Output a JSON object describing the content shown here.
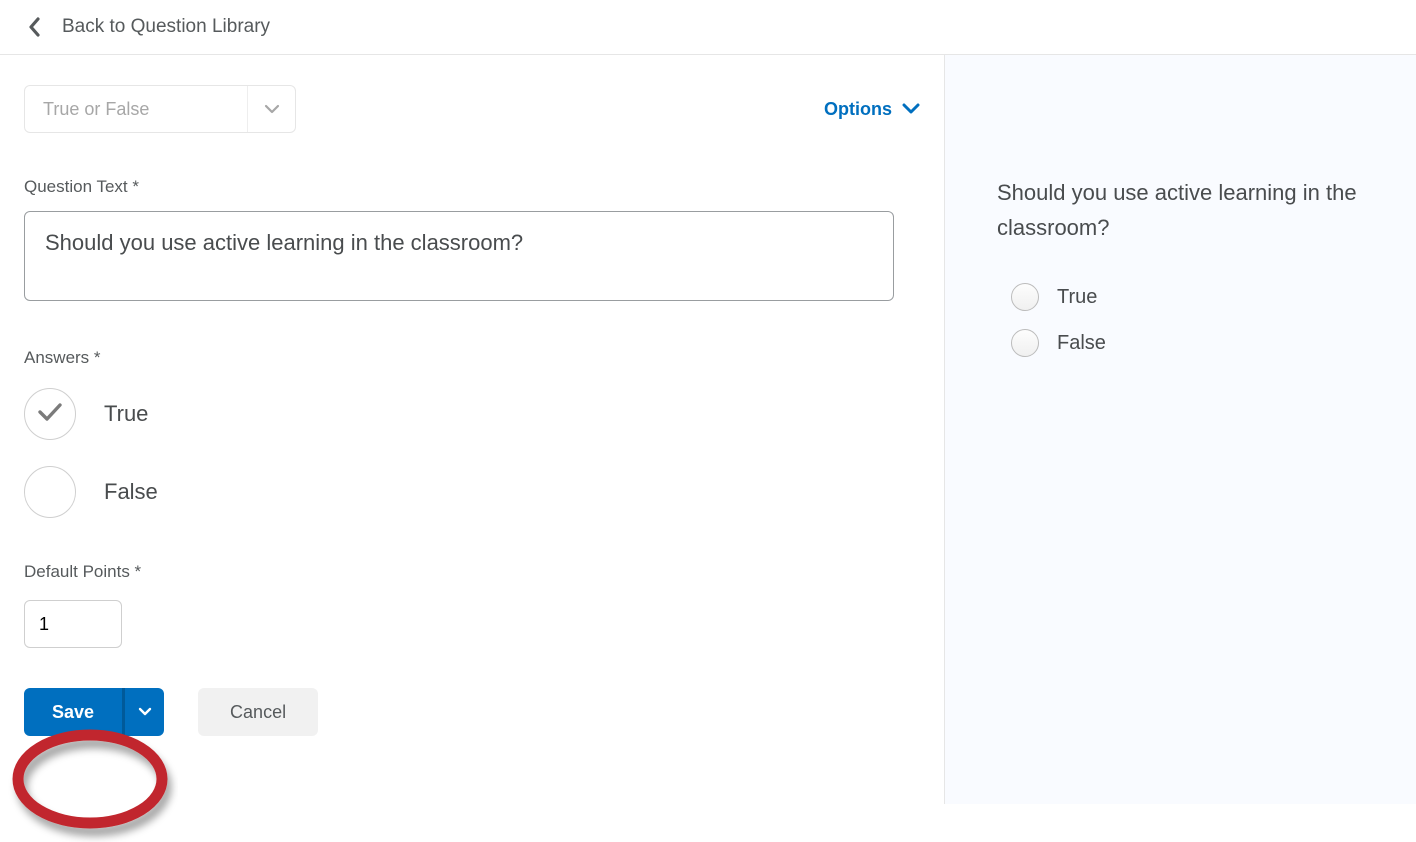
{
  "header": {
    "back_label": "Back to Question Library"
  },
  "editor": {
    "type_label": "True or False",
    "options_label": "Options",
    "question_text_label": "Question Text *",
    "question_text_value": "Should you use active learning in the classroom?",
    "answers_label": "Answers *",
    "answers": {
      "true_label": "True",
      "false_label": "False",
      "correct": "true"
    },
    "default_points_label": "Default Points *",
    "default_points_value": "1",
    "save_label": "Save",
    "cancel_label": "Cancel"
  },
  "preview": {
    "question_text": "Should you use active learning in the classroom?",
    "true_label": "True",
    "false_label": "False"
  },
  "colors": {
    "primary": "#006fbf",
    "highlight": "#c1282d"
  }
}
